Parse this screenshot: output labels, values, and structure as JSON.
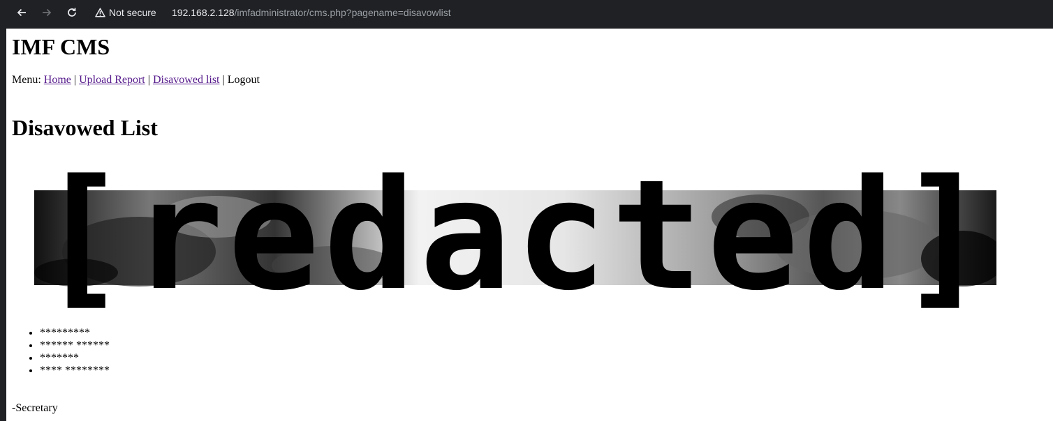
{
  "browser": {
    "security_label": "Not secure",
    "url_host": "192.168.2.128",
    "url_path": "/imfadministrator/cms.php?pagename=disavowlist"
  },
  "page": {
    "site_title": "IMF CMS",
    "menu": {
      "prefix": "Menu:",
      "separator": "|",
      "home": "Home",
      "upload_report": "Upload Report",
      "disavowed_list": "Disavowed list",
      "logout": "Logout"
    },
    "heading": "Disavowed List",
    "banner_text": "[redacted]",
    "items": [
      "*********",
      "****** ******",
      "*******",
      "**** ********"
    ],
    "signature": "-Secretary"
  },
  "colors": {
    "toolbar_bg": "#202124",
    "link_visited": "#551a8b"
  },
  "icons": [
    "back-arrow-icon",
    "forward-arrow-icon",
    "reload-icon",
    "warning-triangle-icon"
  ]
}
